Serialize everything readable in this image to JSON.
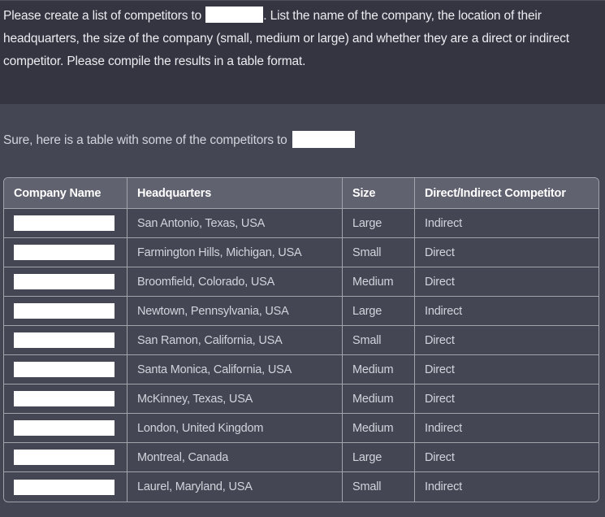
{
  "user_message": {
    "text_before": "Please create a list of competitors to ",
    "redacted": "",
    "text_after": ". List the name of the company, the location of their headquarters, the size of the company (small, medium or large) and whether they are a direct or indirect competitor. Please compile the results in a table format."
  },
  "assistant_message": {
    "intro": "Sure, here is a table with some of the competitors to ",
    "redacted": ""
  },
  "colors": {
    "user_bg": "#343541",
    "assistant_bg": "#444654",
    "table_header_bg": "#606270",
    "border": "#a3a4ab",
    "redaction": "#ffffff"
  },
  "table": {
    "headers": [
      "Company Name",
      "Headquarters",
      "Size",
      "Direct/Indirect Competitor"
    ],
    "rows": [
      {
        "company": "",
        "headquarters": "San Antonio, Texas, USA",
        "size": "Large",
        "competitor_type": "Indirect"
      },
      {
        "company": "",
        "headquarters": "Farmington Hills, Michigan, USA",
        "size": "Small",
        "competitor_type": "Direct"
      },
      {
        "company": "",
        "headquarters": "Broomfield, Colorado, USA",
        "size": "Medium",
        "competitor_type": "Direct"
      },
      {
        "company": "",
        "headquarters": "Newtown, Pennsylvania, USA",
        "size": "Large",
        "competitor_type": "Indirect"
      },
      {
        "company": "",
        "headquarters": "San Ramon, California, USA",
        "size": "Small",
        "competitor_type": "Direct"
      },
      {
        "company": "",
        "headquarters": "Santa Monica, California, USA",
        "size": "Medium",
        "competitor_type": "Direct"
      },
      {
        "company": "",
        "headquarters": "McKinney, Texas, USA",
        "size": "Medium",
        "competitor_type": "Direct"
      },
      {
        "company": "",
        "headquarters": "London, United Kingdom",
        "size": "Medium",
        "competitor_type": "Indirect"
      },
      {
        "company": "",
        "headquarters": "Montreal, Canada",
        "size": "Large",
        "competitor_type": "Direct"
      },
      {
        "company": "",
        "headquarters": "Laurel, Maryland, USA",
        "size": "Small",
        "competitor_type": "Indirect"
      }
    ]
  }
}
